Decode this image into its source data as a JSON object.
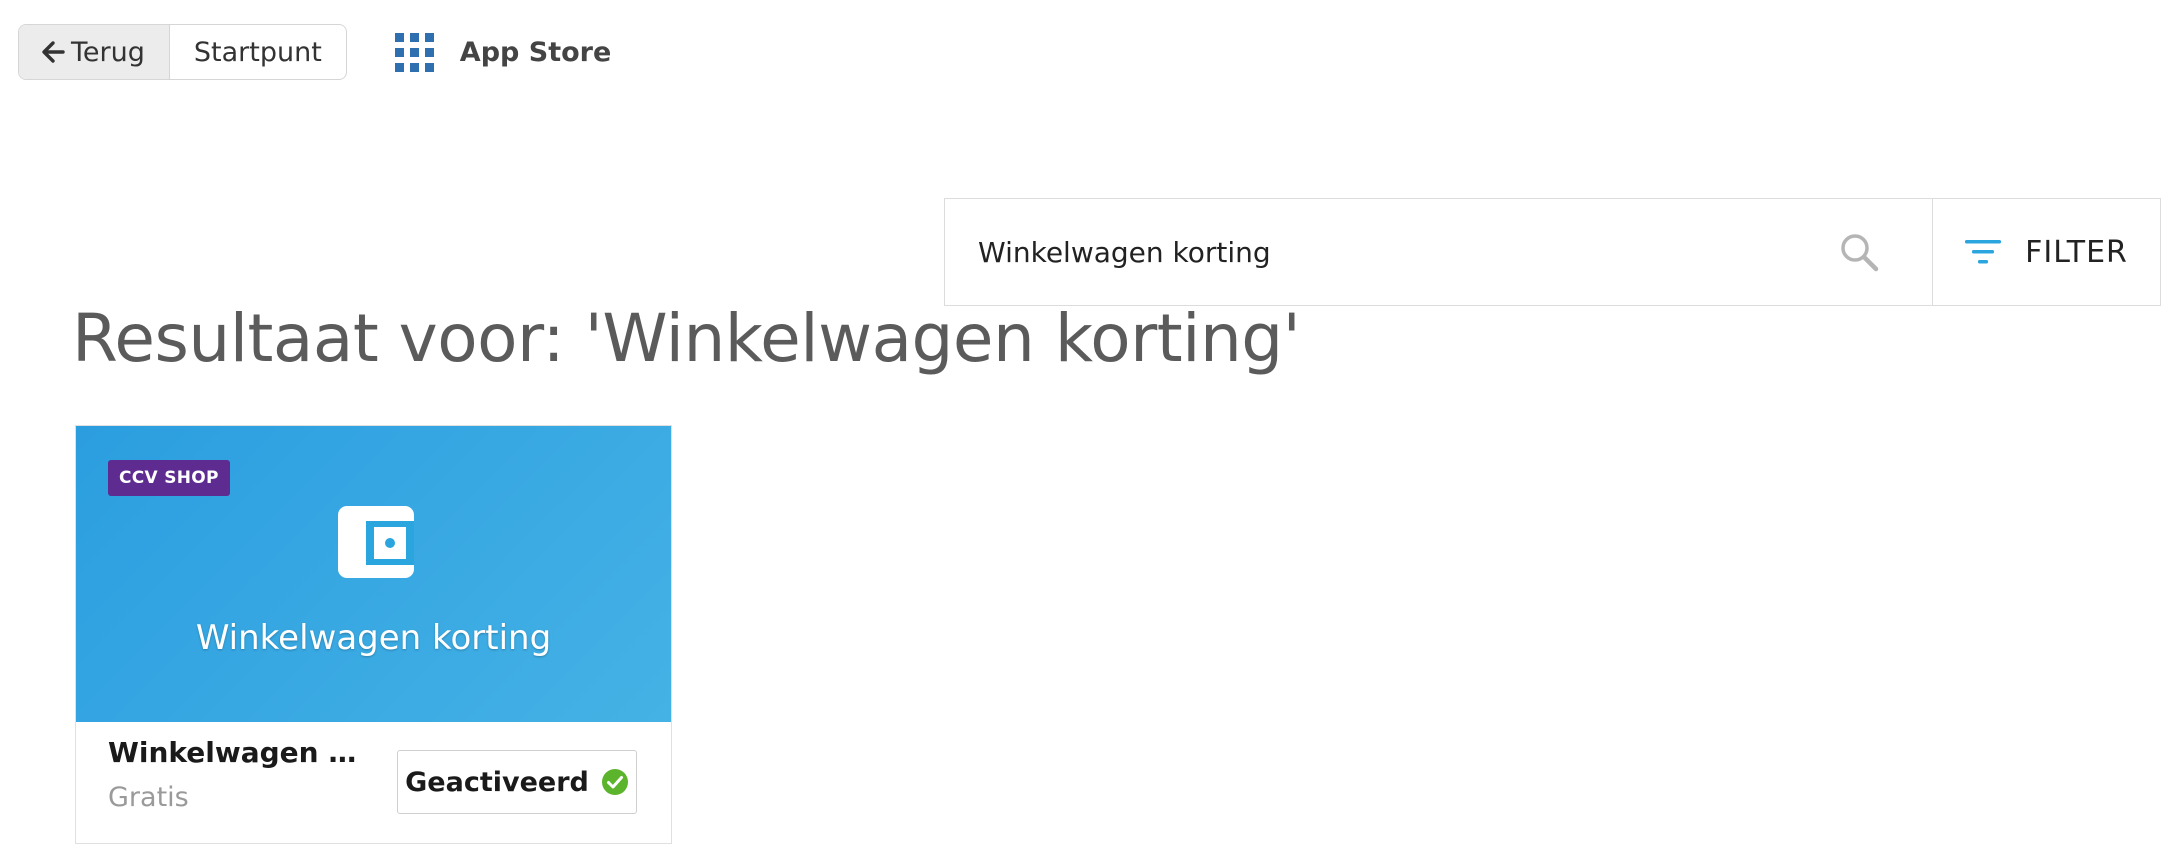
{
  "nav": {
    "back_label": "Terug",
    "home_label": "Startpunt",
    "appstore_label": "App Store",
    "back_icon": "arrow-left-icon",
    "appstore_icon": "grid-icon"
  },
  "search": {
    "value": "Winkelwagen korting",
    "search_icon": "search-icon",
    "filter_label": "FILTER",
    "filter_icon": "filter-icon"
  },
  "results": {
    "heading": "Resultaat voor: 'Winkelwagen korting'"
  },
  "apps": [
    {
      "badge": "CCV SHOP",
      "banner_title": "Winkelwagen korting",
      "name": "Winkelwagen korting",
      "name_display": "Winkelwagen kor...",
      "price": "Gratis",
      "status_label": "Geactiveerd",
      "icon": "wallet-icon",
      "status_icon": "check-circle-icon"
    }
  ],
  "colors": {
    "banner_start": "#2b9ee0",
    "banner_end": "#45b2e5",
    "badge": "#5e2b91",
    "accent": "#2ba5de",
    "grid_icon": "#2e6fb0",
    "check": "#5bb42b"
  }
}
